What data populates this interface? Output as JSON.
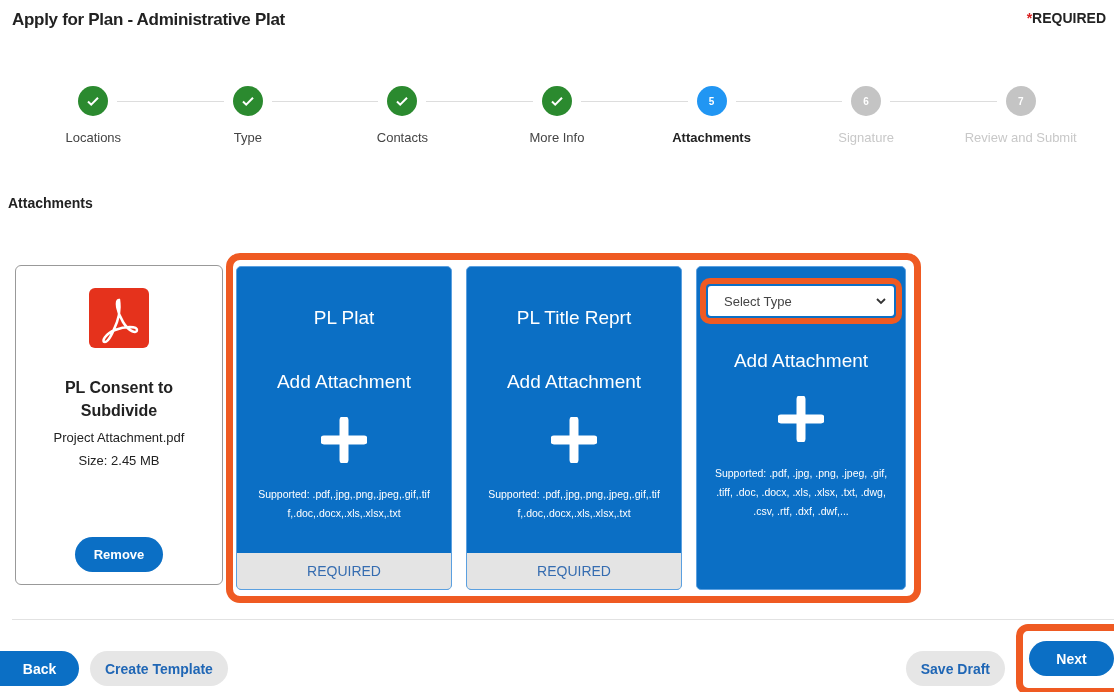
{
  "header": {
    "title": "Apply for Plan - Administrative Plat",
    "required_mark": "*",
    "required_label": "REQUIRED"
  },
  "steps": [
    {
      "label": "Locations",
      "kind": "done"
    },
    {
      "label": "Type",
      "kind": "done"
    },
    {
      "label": "Contacts",
      "kind": "done"
    },
    {
      "label": "More Info",
      "kind": "done"
    },
    {
      "label": "Attachments",
      "kind": "current",
      "number": "5"
    },
    {
      "label": "Signature",
      "kind": "upcoming",
      "number": "6"
    },
    {
      "label": "Review and Submit",
      "kind": "upcoming",
      "number": "7"
    }
  ],
  "section_title": "Attachments",
  "cards": [
    {
      "kind": "uploaded",
      "title": "PL Consent to Subdivide",
      "file": "Project Attachment.pdf",
      "size": "Size: 2.45 MB",
      "button": "Remove"
    },
    {
      "kind": "slot",
      "title": "PL Plat",
      "action": "Add Attachment",
      "supported": "Supported: .pdf,.jpg,.png,.jpeg,.gif,.tiff,.doc,.docx,.xls,.xlsx,.txt",
      "footer": "REQUIRED",
      "highlighted": true
    },
    {
      "kind": "slot",
      "title": "PL Title Reprt",
      "action": "Add Attachment",
      "supported": "Supported: .pdf,.jpg,.png,.jpeg,.gif,.tiff,.doc,.docx,.xls,.xlsx,.txt",
      "footer": "REQUIRED",
      "highlighted": true
    },
    {
      "kind": "typed",
      "select": "Select Type",
      "action": "Add Attachment",
      "supported": "Supported: .pdf, .jpg, .png, .jpeg, .gif, .tiff, .doc, .docx, .xls, .xlsx, .txt, .dwg, .csv, .rtf, .dxf, .dwf,...",
      "highlighted": true
    }
  ],
  "footer": {
    "back": "Back",
    "create_template": "Create Template",
    "save_draft": "Save Draft",
    "next": "Next"
  }
}
